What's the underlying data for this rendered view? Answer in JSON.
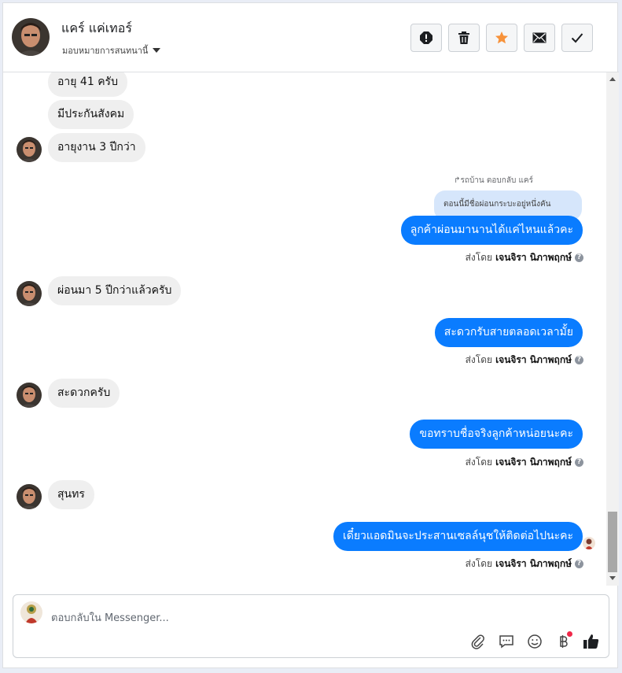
{
  "header": {
    "contact_name": "แคร์ แค่เทอร์",
    "assign_label": "มอบหมายการสนทนานี้",
    "actions": [
      {
        "name": "report-spam-button",
        "icon": "exclamation-icon"
      },
      {
        "name": "delete-button",
        "icon": "trash-icon"
      },
      {
        "name": "star-button",
        "icon": "star-icon",
        "color": "#f7923a"
      },
      {
        "name": "mark-unread-button",
        "icon": "envelope-icon"
      },
      {
        "name": "mark-done-button",
        "icon": "check-icon"
      }
    ]
  },
  "messages": {
    "m1": "อายุ 41 ครับ",
    "m2": "มีประกันสังคม",
    "m3": "อายุงาน 3 ปีกว่า",
    "reply_meta": "รถบ้าน ตอบกลับ แคร์",
    "quoted": "ตอนนี้มีชื่อผ่อนกระบะอยู่หนึ่งคัน",
    "m4": "ลูกค้าผ่อนมานานได้แค่ไหนแล้วคะ",
    "m5": "ผ่อนมา 5 ปีกว่าแล้วครับ",
    "m6": "สะดวกรับสายตลอดเวลามั้ย",
    "m7": "สะดวกครับ",
    "m8": "ขอทราบชื่อจริงลูกค้าหน่อยนะคะ",
    "m9": "สุนทร",
    "m10": "เดี๋ยวแอดมินจะประสานเซลล์นุชให้ติดต่อไปนะคะ"
  },
  "sent_by": {
    "prefix": "ส่งโดย",
    "agent": "เจนจิรา นิภาพฤกษ์",
    "help": "?"
  },
  "composer": {
    "placeholder": "ตอบกลับใน Messenger...",
    "tools": [
      "paperclip-icon",
      "chat-bubble-icon",
      "smiley-icon",
      "baht-icon",
      "thumbs-up-icon"
    ]
  },
  "colors": {
    "outgoing_bubble": "#0a7cff",
    "incoming_bubble": "#efefef",
    "star": "#f7923a"
  }
}
